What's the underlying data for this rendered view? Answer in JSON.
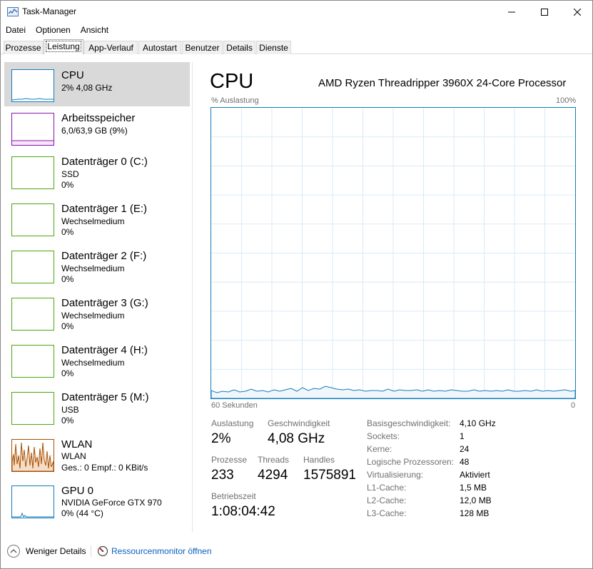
{
  "window": {
    "title": "Task-Manager"
  },
  "menu": [
    "Datei",
    "Optionen",
    "Ansicht"
  ],
  "tabs": [
    "Prozesse",
    "Leistung",
    "App-Verlauf",
    "Autostart",
    "Benutzer",
    "Details",
    "Dienste"
  ],
  "sidebar": {
    "items": [
      {
        "name": "CPU",
        "sub1": "2% 4,08 GHz",
        "color": "#117dbb"
      },
      {
        "name": "Arbeitsspeicher",
        "sub1": "6,0/63,9 GB (9%)",
        "color": "#8b12ae"
      },
      {
        "name": "Datenträger 0 (C:)",
        "sub1": "SSD",
        "sub2": "0%",
        "color": "#4da60c"
      },
      {
        "name": "Datenträger 1 (E:)",
        "sub1": "Wechselmedium",
        "sub2": "0%",
        "color": "#4da60c"
      },
      {
        "name": "Datenträger 2 (F:)",
        "sub1": "Wechselmedium",
        "sub2": "0%",
        "color": "#4da60c"
      },
      {
        "name": "Datenträger 3 (G:)",
        "sub1": "Wechselmedium",
        "sub2": "0%",
        "color": "#4da60c"
      },
      {
        "name": "Datenträger 4 (H:)",
        "sub1": "Wechselmedium",
        "sub2": "0%",
        "color": "#4da60c"
      },
      {
        "name": "Datenträger 5 (M:)",
        "sub1": "USB",
        "sub2": "0%",
        "color": "#4da60c"
      },
      {
        "name": "WLAN",
        "sub1": "WLAN",
        "sub2": "Ges.: 0 Empf.: 0 KBit/s",
        "color": "#a74f01"
      },
      {
        "name": "GPU 0",
        "sub1": "NVIDIA GeForce GTX 970",
        "sub2": "0% (44 °C)",
        "color": "#117dbb"
      }
    ]
  },
  "main": {
    "title": "CPU",
    "processor": "AMD Ryzen Threadripper 3960X 24-Core Processor",
    "graph": {
      "top_left": "% Auslastung",
      "top_right": "100%",
      "bottom_left": "60 Sekunden",
      "bottom_right": "0",
      "color": "#117dbb"
    },
    "stats": {
      "utilization_label": "Auslastung",
      "utilization": "2%",
      "speed_label": "Geschwindigkeit",
      "speed": "4,08 GHz",
      "processes_label": "Prozesse",
      "processes": "233",
      "threads_label": "Threads",
      "threads": "4294",
      "handles_label": "Handles",
      "handles": "1575891",
      "uptime_label": "Betriebszeit",
      "uptime": "1:08:04:42"
    },
    "info": [
      {
        "label": "Basisgeschwindigkeit:",
        "value": "4,10 GHz"
      },
      {
        "label": "Sockets:",
        "value": "1"
      },
      {
        "label": "Kerne:",
        "value": "24"
      },
      {
        "label": "Logische Prozessoren:",
        "value": "48"
      },
      {
        "label": "Virtualisierung:",
        "value": "Aktiviert"
      },
      {
        "label": "L1-Cache:",
        "value": "1,5 MB"
      },
      {
        "label": "L2-Cache:",
        "value": "12,0 MB"
      },
      {
        "label": "L3-Cache:",
        "value": "128 MB"
      }
    ]
  },
  "footer": {
    "less_details": "Weniger Details",
    "resource_monitor": "Ressourcenmonitor öffnen"
  }
}
